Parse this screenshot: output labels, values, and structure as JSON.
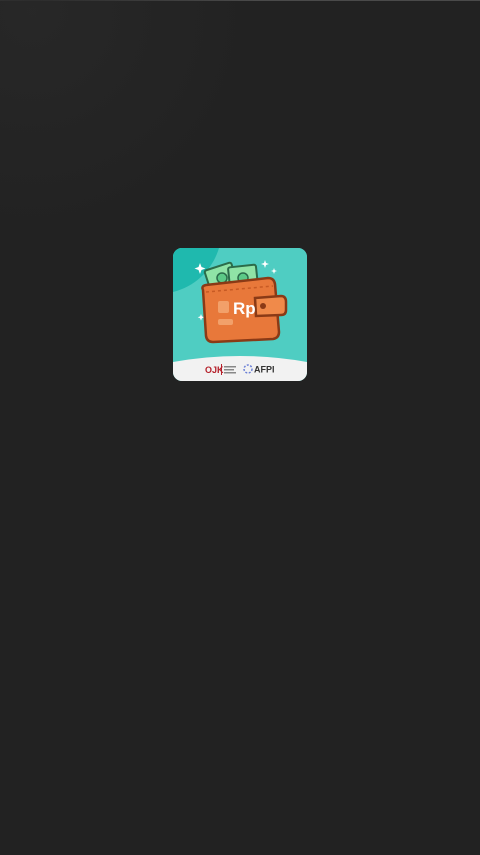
{
  "app": {
    "splash": {
      "icon_name": "wallet-rupiah-app-icon",
      "wallet_text": "Rp",
      "ojk_logo_text": "OJK",
      "afpi_logo_text": "AFPI"
    }
  },
  "colors": {
    "background": "#222222",
    "icon_teal": "#4fcdc2",
    "icon_teal_dark": "#1fb9ae",
    "wallet_orange": "#e8783a",
    "wallet_dark": "#c75a24",
    "money_green": "#8fe3a6",
    "footer_white": "#f2f2f2"
  }
}
